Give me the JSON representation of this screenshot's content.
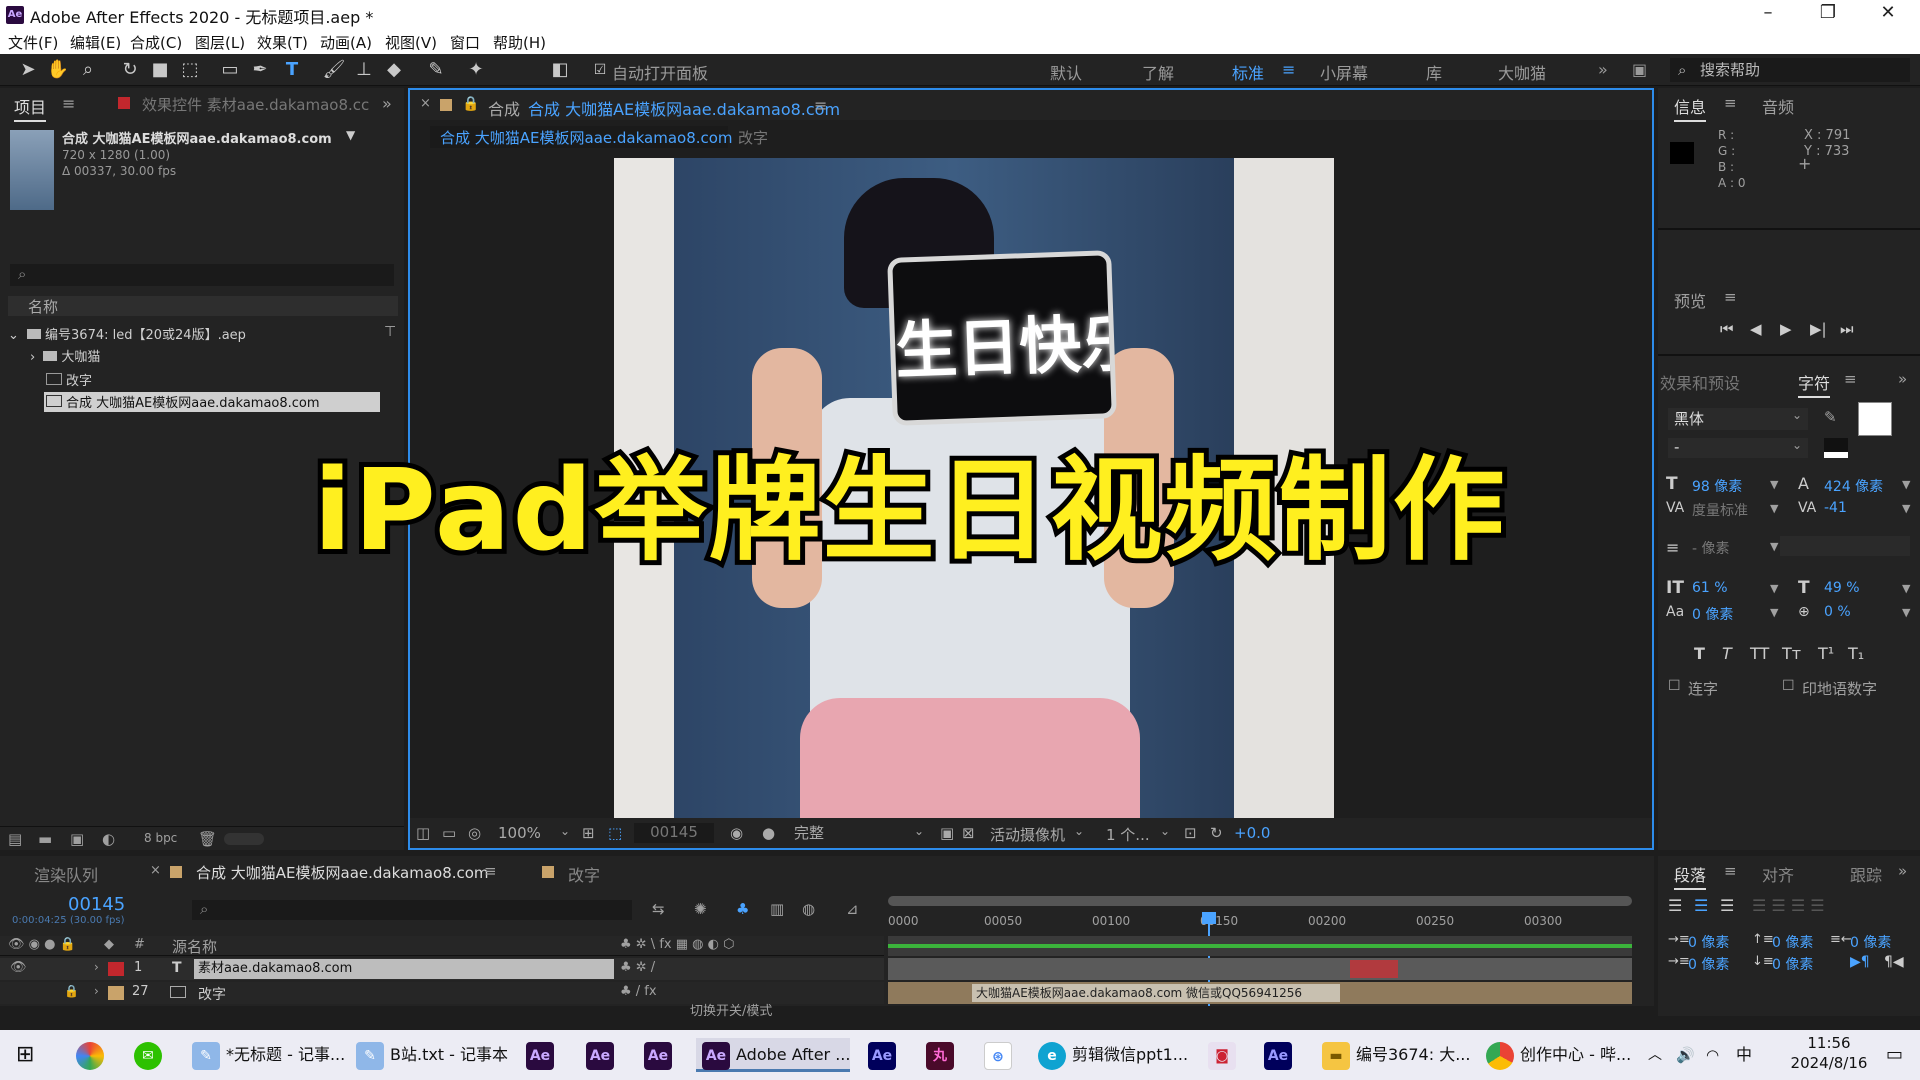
{
  "title_bar": {
    "title": "Adobe After Effects 2020 - 无标题项目.aep *",
    "logo": "Ae"
  },
  "menu": [
    "文件(F)",
    "编辑(E)",
    "合成(C)",
    "图层(L)",
    "效果(T)",
    "动画(A)",
    "视图(V)",
    "窗口",
    "帮助(H)"
  ],
  "toolbar": {
    "auto_open": "自动打开面板",
    "workspaces": [
      "默认",
      "了解",
      "标准",
      "小屏幕",
      "库",
      "大咖猫"
    ],
    "active_workspace": "标准",
    "search_help": "搜索帮助"
  },
  "project": {
    "tab_project": "项目",
    "tab_effects": "效果控件 素材aae.dakamao8.cc",
    "selected_name": "合成 大咖猫AE模板网aae.dakamao8.com",
    "dims": "720 x 1280 (1.00)",
    "duration": "Δ 00337, 30.00 fps",
    "col_name": "名称",
    "tree": [
      "编号3674: led【20或24版】.aep",
      "大咖猫",
      "改字",
      "合成 大咖猫AE模板网aae.dakamao8.com"
    ],
    "bpc": "8 bpc"
  },
  "viewer": {
    "tab_title": "合成 大咖猫AE模板网aae.dakamao8.com",
    "tab_prefix": "合成",
    "breadcrumb_active": "合成 大咖猫AE模板网aae.dakamao8.com",
    "breadcrumb_next": "改字",
    "sign_text": "生日快乐",
    "overlay_text": "iPad举牌生日视频制作",
    "zoom": "100%",
    "timecode": "00145",
    "quality": "完整",
    "camera": "活动摄像机",
    "views": "1 个...",
    "exposure": "+0.0"
  },
  "info": {
    "tab_info": "信息",
    "tab_audio": "音频",
    "r": "R :",
    "g": "G :",
    "b": "B :",
    "a": "A : 0",
    "x": "X : 791",
    "y": "Y : 733"
  },
  "preview": {
    "title": "预览"
  },
  "character": {
    "tab_effects": "效果和预设",
    "tab_char": "字符",
    "font": "黑体",
    "style": "-",
    "size": "98 像素",
    "leading": "424 像素",
    "kerning": "度量标准",
    "tracking": "-41",
    "stroke": "- 像素",
    "vscale": "61 %",
    "hscale": "49 %",
    "baseline": "0 像素",
    "tsume": "0 %",
    "ligature": "连字",
    "hindi": "印地语数字"
  },
  "timeline": {
    "tab_render": "渲染队列",
    "tab_comp": "合成 大咖猫AE模板网aae.dakamao8.com",
    "tab_edit": "改字",
    "timecode": "00145",
    "sub_timecode": "0:00:04:25 (30.00 fps)",
    "col_source": "源名称",
    "ruler": [
      "0000",
      "00050",
      "00100",
      "00150",
      "00200",
      "00250",
      "00300"
    ],
    "layers": [
      {
        "num": "1",
        "name": "素材aae.dakamao8.com"
      },
      {
        "num": "27",
        "name": "改字"
      }
    ],
    "bar_text": "大咖猫AE模板网aae.dakamao8.com  微信或QQ56941256",
    "switch_mode": "切换开关/模式"
  },
  "paragraph": {
    "tab_para": "段落",
    "tab_align": "对齐",
    "tab_track": "跟踪",
    "indent": "0 像素"
  },
  "taskbar": {
    "items": [
      "*无标题 - 记事...",
      "B站.txt - 记事本",
      "Adobe After ...",
      "剪辑微信ppt1...",
      "编号3674: 大...",
      "创作中心 - 哔..."
    ],
    "ime": "中",
    "time": "11:56",
    "date": "2024/8/16"
  },
  "colors": {
    "accent": "#2d8ceb",
    "overlay_yellow": "#ffef1f",
    "ae_purple": "#2a0a3f"
  }
}
